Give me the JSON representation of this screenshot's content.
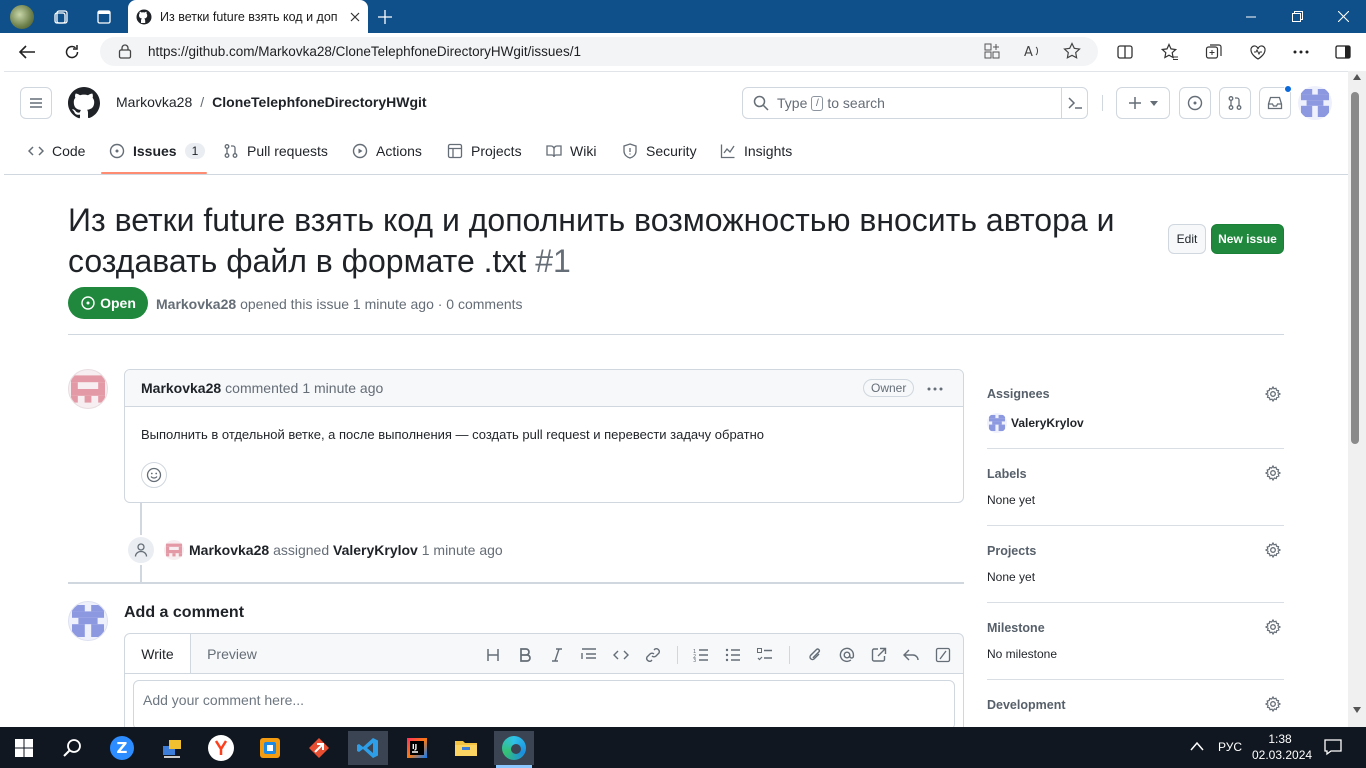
{
  "browser": {
    "tab_title": "Из ветки future взять код и доп",
    "url": "https://github.com/Markovka28/CloneTelephfoneDirectoryHWgit/issues/1"
  },
  "header": {
    "owner": "Markovka28",
    "separator": "/",
    "repo": "CloneTelephfoneDirectoryHWgit",
    "search_type": "Type",
    "search_key": "/",
    "search_rest": "to search",
    "plus": "+"
  },
  "repo_nav": {
    "code": "Code",
    "issues": "Issues",
    "issues_count": "1",
    "pulls": "Pull requests",
    "actions": "Actions",
    "projects": "Projects",
    "wiki": "Wiki",
    "security": "Security",
    "insights": "Insights"
  },
  "issue": {
    "title": "Из ветки future взять код и дополнить возможностью вносить автора и создавать файл в формате .txt",
    "number": "#1",
    "edit_label": "Edit",
    "new_issue_label": "New issue",
    "state": "Open",
    "author": "Markovka28",
    "meta": "opened this issue 1 minute ago · 0 comments"
  },
  "comment": {
    "author": "Markovka28",
    "action": "commented",
    "time": "1 minute ago",
    "badge": "Owner",
    "body": "Выполнить в отдельной ветке, а после выполнения — создать pull request и перевести задачу обратно"
  },
  "event": {
    "actor": "Markovka28",
    "action": "assigned",
    "target": "ValeryKrylov",
    "time": "1 minute ago"
  },
  "add_comment": {
    "heading": "Add a comment",
    "tab_write": "Write",
    "tab_preview": "Preview",
    "placeholder": "Add your comment here..."
  },
  "sidebar": {
    "assignees_label": "Assignees",
    "assignee": "ValeryKrylov",
    "labels_label": "Labels",
    "labels_value": "None yet",
    "projects_label": "Projects",
    "projects_value": "None yet",
    "milestone_label": "Milestone",
    "milestone_value": "No milestone",
    "development_label": "Development"
  },
  "taskbar": {
    "lang": "РУС",
    "time": "1:38",
    "date": "02.03.2024"
  },
  "colors": {
    "green": "#1f883d",
    "accent_underline": "#fd8c73",
    "link_muted": "#656d76"
  }
}
